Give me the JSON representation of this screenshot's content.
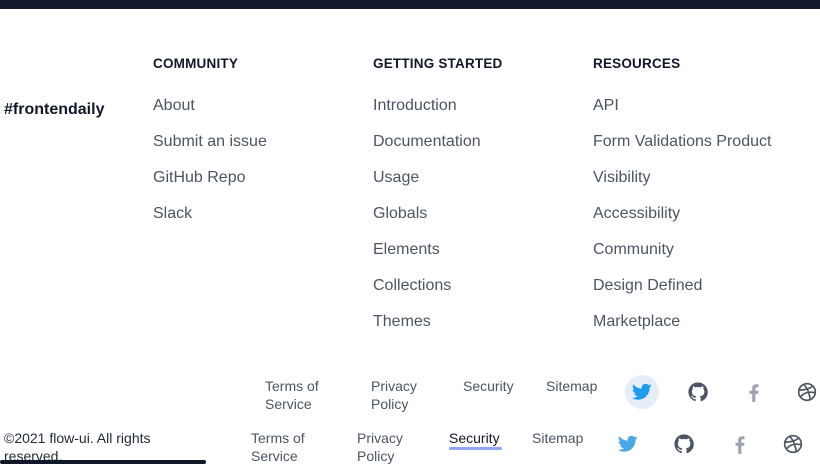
{
  "brand": "#frontendaily",
  "columns": [
    {
      "title": "COMMUNITY",
      "links": [
        "About",
        "Submit an issue",
        "GitHub Repo",
        "Slack"
      ]
    },
    {
      "title": "GETTING STARTED",
      "links": [
        "Introduction",
        "Documentation",
        "Usage",
        "Globals",
        "Elements",
        "Collections",
        "Themes"
      ]
    },
    {
      "title": "RESOURCES",
      "links": [
        "API",
        "Form Validations Product",
        "Visibility",
        "Accessibility",
        "Community",
        "Design Defined",
        "Marketplace"
      ]
    }
  ],
  "legal_row_1": {
    "terms": "Terms of Service",
    "privacy": "Privacy Policy",
    "security": "Security",
    "sitemap": "Sitemap"
  },
  "legal_row_2": {
    "copyright": "©2021 flow-ui. All rights reserved.",
    "terms": "Terms of Service",
    "privacy": "Privacy Policy",
    "security": "Security",
    "sitemap": "Sitemap"
  },
  "social_icons": [
    "twitter-icon",
    "github-icon",
    "facebook-icon",
    "dribbble-icon"
  ],
  "colors": {
    "topbar": "#141a2e",
    "twitter": "#1d9bf0",
    "active_underline": "#93a4f5",
    "icon_gray": "#6b7280"
  }
}
